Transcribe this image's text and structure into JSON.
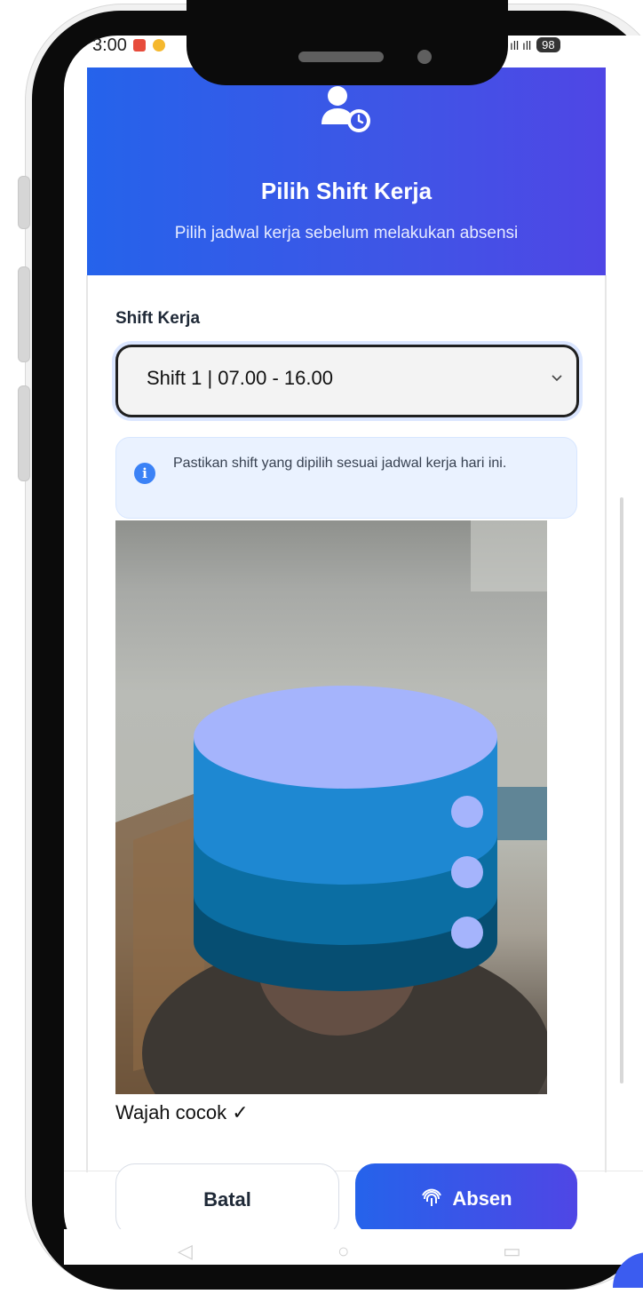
{
  "status_bar": {
    "time": "3:00",
    "signal": "ıll ıll",
    "battery": "98"
  },
  "header": {
    "icon": "user-clock-icon",
    "title": "Pilih Shift Kerja",
    "subtitle": "Pilih jadwal kerja sebelum melakukan absensi"
  },
  "form": {
    "shift_label": "Shift Kerja",
    "shift_selected": "Shift 1 | 07.00 - 16.00",
    "info_icon": "info-circle-icon",
    "info_text": "Pastikan shift yang dipilih sesuai jadwal kerja hari ini."
  },
  "camera": {
    "overlay_icon": "database-icon",
    "face_status": "Wajah cocok ✓"
  },
  "actions": {
    "cancel_label": "Batal",
    "submit_label": "Absen",
    "submit_icon": "fingerprint-icon"
  },
  "colors": {
    "primary": "#2563eb",
    "primary_end": "#4f46e5",
    "info_bg": "#eaf2ff",
    "db_top": "#a5b4fc",
    "db_band_1": "#1e88d2",
    "db_band_2": "#0b6ea3",
    "db_band_3": "#064e72"
  }
}
